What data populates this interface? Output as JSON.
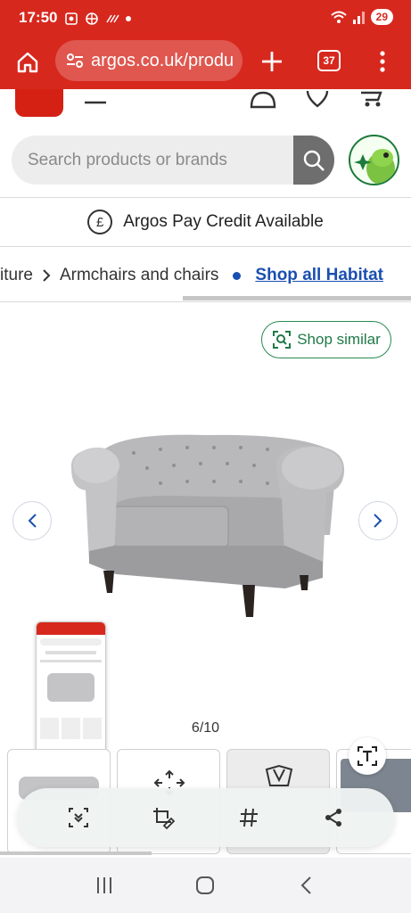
{
  "status_bar": {
    "time": "17:50",
    "battery": "29"
  },
  "browser": {
    "url": "argos.co.uk/produ",
    "tab_count": "37"
  },
  "header": {
    "search_placeholder": "Search products or brands"
  },
  "credit_banner": {
    "text": "Argos Pay Credit Available",
    "icon": "pound-circle-icon"
  },
  "breadcrumb": {
    "items": [
      "iture",
      "Armchairs and chairs"
    ],
    "shop_all_link": "Shop all Habitat"
  },
  "product": {
    "shop_similar_label": "Shop similar",
    "image_counter": "6/10"
  },
  "colors": {
    "brand_red": "#d7281e",
    "link_blue": "#1a4fb0",
    "similar_green": "#1f7a47"
  }
}
